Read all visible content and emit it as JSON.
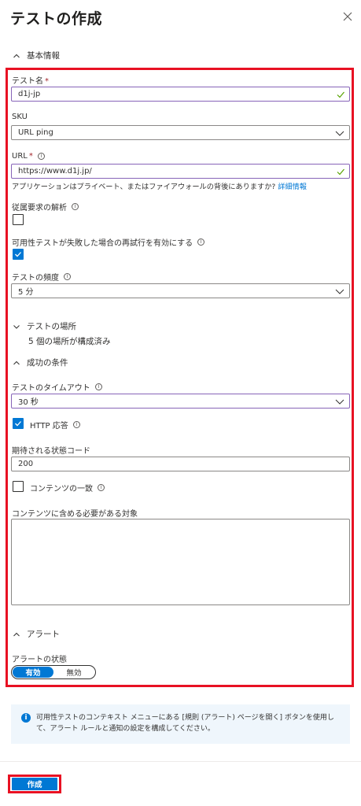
{
  "panel": {
    "title": "テストの作成"
  },
  "sections": {
    "basic": "基本情報",
    "locations": "テストの場所",
    "locations_summary": "5 個の場所が構成済み",
    "success": "成功の条件",
    "alerts": "アラート"
  },
  "form": {
    "test_name": {
      "label": "テスト名",
      "required": "*",
      "value": "d1j-jp"
    },
    "sku": {
      "label": "SKU",
      "value": "URL ping"
    },
    "url": {
      "label": "URL",
      "required": "*",
      "value": "https://www.d1j.jp/",
      "help": "アプリケーションはプライベート、またはファイアウォールの背後にありますか?",
      "help_link": "詳細情報"
    },
    "parse_dependent": {
      "label": "従属要求の解析",
      "checked": false
    },
    "retry": {
      "label": "可用性テストが失敗した場合の再試行を有効にする",
      "checked": true
    },
    "frequency": {
      "label": "テストの頻度",
      "value": "5 分"
    },
    "timeout": {
      "label": "テストのタイムアウト",
      "value": "30 秒"
    },
    "http_response": {
      "label": "HTTP 応答",
      "checked": true
    },
    "expected_status": {
      "label": "期待される状態コード",
      "value": "200"
    },
    "content_match": {
      "label": "コンテンツの一致",
      "checked": false
    },
    "content_must_contain": {
      "label": "コンテンツに含める必要がある対象",
      "value": ""
    },
    "alert_state": {
      "label": "アラートの状態",
      "on": "有効",
      "off": "無効",
      "selected": "有効"
    }
  },
  "info_bar": {
    "text": "可用性テストのコンテキスト メニューにある [規則 (アラート) ページを開く] ボタンを使用して、アラート ルールと通知の設定を構成してください。"
  },
  "footer": {
    "create_label": "作成"
  },
  "colors": {
    "accent": "#0078d4",
    "highlight": "#e81123",
    "valid_border": "#8764b8",
    "valid_check": "#57a300"
  }
}
